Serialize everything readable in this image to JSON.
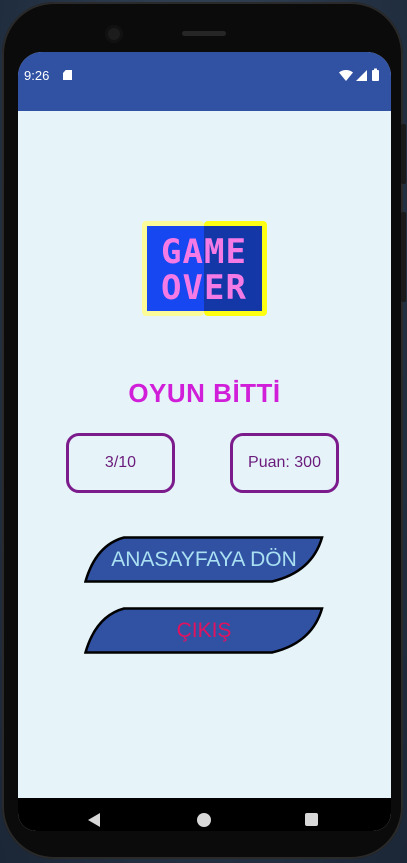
{
  "status_bar": {
    "time": "9:26",
    "icons": [
      "sd-card-icon",
      "wifi-icon",
      "signal-icon",
      "battery-icon"
    ]
  },
  "game_over_logo": {
    "line1": "GAME",
    "line2": "OVER",
    "colors": {
      "outer_left": "#fbfb9a",
      "outer_right": "#ffff14",
      "inner_left": "#1747f0",
      "inner_right": "#1437a8",
      "letters": "#f47ae6"
    }
  },
  "result": {
    "title": "OYUN BİTTİ",
    "score_ratio": "3/10",
    "points_label": "Puan: 300"
  },
  "actions": {
    "home_label": "ANASAYFAYA DÖN",
    "exit_label": "ÇIKIŞ"
  },
  "colors": {
    "status_bar": "#3151a3",
    "background": "#e6f4fa",
    "title": "#d11ed9",
    "box_border": "#7b1b8c",
    "button_fill": "#3151a3",
    "home_text": "#a9e0f2",
    "exit_text": "#e3125f"
  },
  "nav_bar": {
    "icons": [
      "back-icon",
      "home-icon",
      "recents-icon"
    ]
  }
}
